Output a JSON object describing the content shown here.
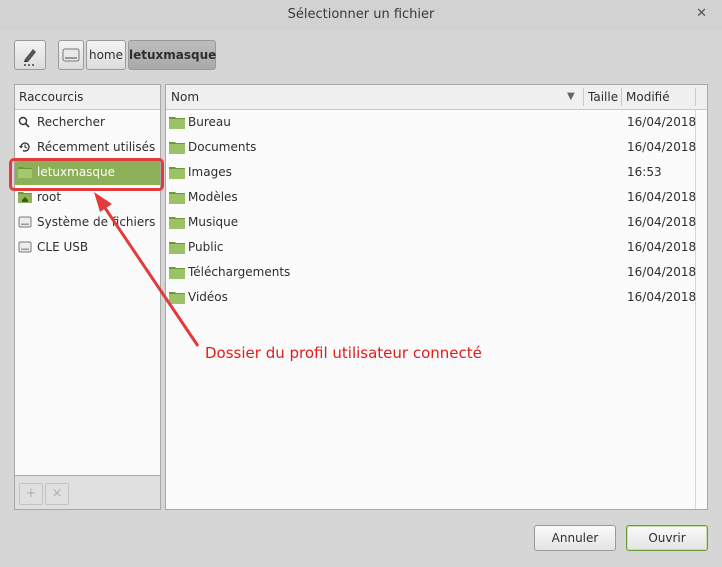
{
  "window": {
    "title": "Sélectionner un fichier",
    "close": "✕"
  },
  "breadcrumb": {
    "home": "home",
    "current": "letuxmasque"
  },
  "sidebar": {
    "header": "Raccourcis",
    "items": [
      {
        "label": "Rechercher",
        "icon": "search-icon"
      },
      {
        "label": "Récemment utilisés",
        "icon": "recent-icon"
      },
      {
        "label": "letuxmasque",
        "icon": "folder-icon",
        "selected": true
      },
      {
        "label": "root",
        "icon": "home-folder-icon"
      },
      {
        "label": "Système de fichiers",
        "icon": "drive-icon"
      },
      {
        "label": "CLE USB",
        "icon": "usb-drive-icon"
      }
    ],
    "add": "+",
    "remove": "×"
  },
  "filelist": {
    "columns": {
      "name": "Nom",
      "size": "Taille",
      "modified": "Modifié"
    },
    "rows": [
      {
        "name": "Bureau",
        "modified": "16/04/2018"
      },
      {
        "name": "Documents",
        "modified": "16/04/2018"
      },
      {
        "name": "Images",
        "modified": "16:53"
      },
      {
        "name": "Modèles",
        "modified": "16/04/2018"
      },
      {
        "name": "Musique",
        "modified": "16/04/2018"
      },
      {
        "name": "Public",
        "modified": "16/04/2018"
      },
      {
        "name": "Téléchargements",
        "modified": "16/04/2018"
      },
      {
        "name": "Vidéos",
        "modified": "16/04/2018"
      }
    ]
  },
  "annotation": {
    "text": "Dossier du profil utilisateur connecté",
    "color": "#e31b1b"
  },
  "buttons": {
    "cancel": "Annuler",
    "open": "Ouvrir"
  },
  "colors": {
    "selected": "#8cb058",
    "folder": "#7fa54a"
  }
}
